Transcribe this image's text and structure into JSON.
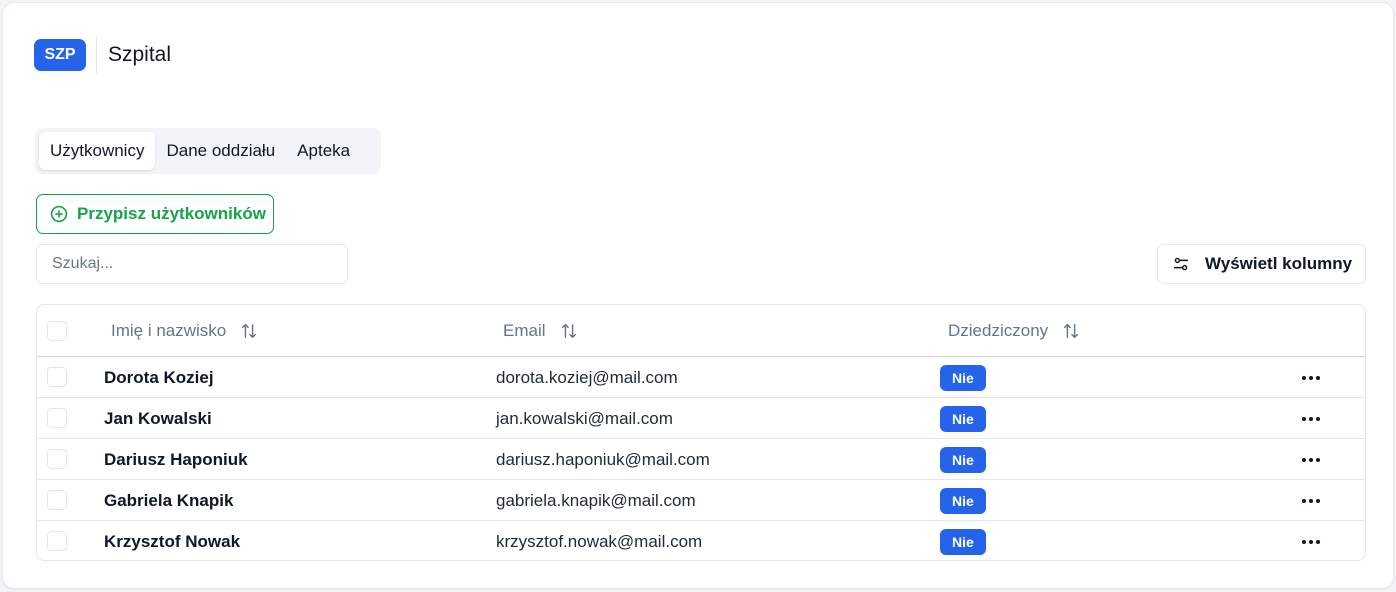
{
  "header": {
    "badge": "SZP",
    "title": "Szpital"
  },
  "tabs": [
    {
      "label": "Użytkownicy",
      "active": true
    },
    {
      "label": "Dane oddziału",
      "active": false
    },
    {
      "label": "Apteka",
      "active": false
    }
  ],
  "actions": {
    "assign_label": "Przypisz użytkowników",
    "assign_icon": "plus-circle-icon",
    "columns_label": "Wyświetl kolumny",
    "columns_icon": "sliders-icon"
  },
  "search": {
    "placeholder": "Szukaj...",
    "value": ""
  },
  "table": {
    "columns": [
      {
        "label": "Imię i nazwisko",
        "sort_icon": "sort-icon"
      },
      {
        "label": "Email",
        "sort_icon": "sort-icon"
      },
      {
        "label": "Dziedziczony",
        "sort_icon": "sort-icon"
      }
    ],
    "rows": [
      {
        "name": "Dorota Koziej",
        "email": "dorota.koziej@mail.com",
        "inherited": "Nie"
      },
      {
        "name": "Jan Kowalski",
        "email": "jan.kowalski@mail.com",
        "inherited": "Nie"
      },
      {
        "name": "Dariusz Haponiuk",
        "email": "dariusz.haponiuk@mail.com",
        "inherited": "Nie"
      },
      {
        "name": "Gabriela Knapik",
        "email": "gabriela.knapik@mail.com",
        "inherited": "Nie"
      },
      {
        "name": "Krzysztof Nowak",
        "email": "krzysztof.nowak@mail.com",
        "inherited": "Nie"
      }
    ]
  },
  "colors": {
    "primary": "#2563eb",
    "success": "#16a34a",
    "muted_text": "#64748b",
    "border": "#e2e8f0"
  }
}
